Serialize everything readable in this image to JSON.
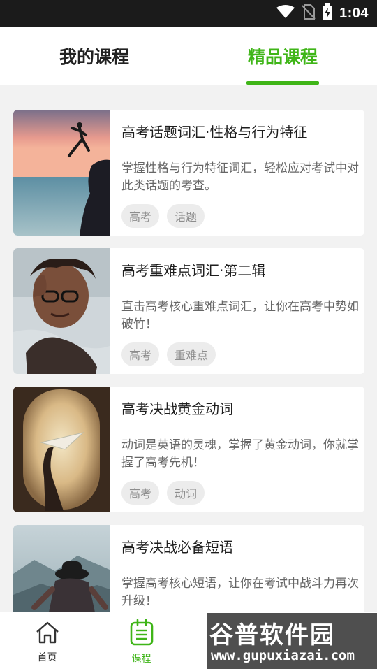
{
  "status_bar": {
    "time": "1:04"
  },
  "tabs": {
    "left": "我的课程",
    "right": "精品课程",
    "active": "right"
  },
  "courses": [
    {
      "title": "高考话题词汇·性格与行为特征",
      "desc": "掌握性格与行为特征词汇，轻松应对考试中对此类话题的考查。",
      "tags": [
        "高考",
        "话题"
      ]
    },
    {
      "title": "高考重难点词汇·第二辑",
      "desc": "直击高考核心重难点词汇，让你在高考中势如破竹！",
      "tags": [
        "高考",
        "重难点"
      ]
    },
    {
      "title": "高考决战黄金动词",
      "desc": "动词是英语的灵魂，掌握了黄金动词，你就掌握了高考先机！",
      "tags": [
        "高考",
        "动词"
      ]
    },
    {
      "title": "高考决战必备短语",
      "desc": "掌握高考核心短语，让你在考试中战斗力再次升级！",
      "tags": []
    }
  ],
  "bottom_nav": {
    "home": "首页",
    "course": "课程"
  },
  "watermark": {
    "logo": "谷普软件园",
    "url": "www.gupuxiazai.com"
  },
  "colors": {
    "accent": "#3fb518"
  }
}
